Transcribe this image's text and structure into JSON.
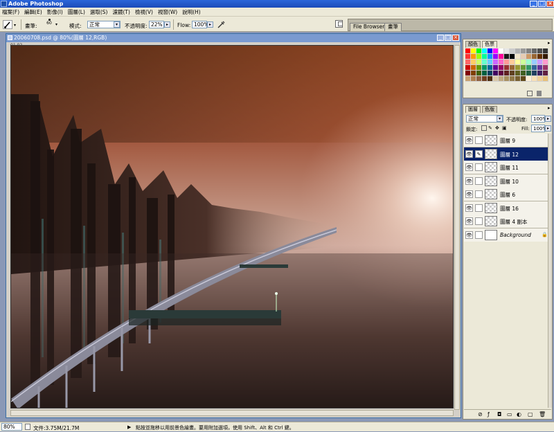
{
  "app": {
    "title": "Adobe Photoshop"
  },
  "menu": [
    "檔案(F)",
    "編輯(E)",
    "影像(I)",
    "圖層(L)",
    "選取(S)",
    "濾鏡(T)",
    "檢視(V)",
    "視窗(W)",
    "說明(H)"
  ],
  "options": {
    "brush_label": "畫筆:",
    "brush_size": "60",
    "mode_label": "模式:",
    "mode_value": "正常",
    "opacity_label": "不透明度:",
    "opacity_value": "22%",
    "flow_label": "Flow:",
    "flow_value": "100%",
    "well_tabs": [
      "File Browser",
      "畫筆"
    ]
  },
  "document": {
    "title": "20060708.psd @ 80%(圖層 12,RGB)",
    "corner_label": "01 02"
  },
  "swatches_panel": {
    "tabs": [
      "顏色",
      "色票"
    ],
    "colors": [
      "#ff0000",
      "#ffff00",
      "#00ff00",
      "#00ffff",
      "#0000ff",
      "#ff00ff",
      "#ffffff",
      "#e6e6e6",
      "#cccccc",
      "#b3b3b3",
      "#999999",
      "#808080",
      "#666666",
      "#4d4d4d",
      "#333333",
      "#ff3333",
      "#ff9900",
      "#99ff00",
      "#00ff99",
      "#0099ff",
      "#9900ff",
      "#ff0099",
      "#1a1a1a",
      "#000000",
      "#f2e6cc",
      "#e6ccb3",
      "#cc9966",
      "#996633",
      "#663300",
      "#331a00",
      "#ff6666",
      "#ffcc66",
      "#ccff66",
      "#66ffcc",
      "#66ccff",
      "#cc66ff",
      "#ff66cc",
      "#ff9999",
      "#ffcc99",
      "#ffff99",
      "#ccff99",
      "#99ffcc",
      "#99ccff",
      "#cc99ff",
      "#ff99cc",
      "#cc0000",
      "#cc6600",
      "#669900",
      "#009966",
      "#006699",
      "#660099",
      "#990066",
      "#993333",
      "#996633",
      "#999933",
      "#669933",
      "#339966",
      "#336699",
      "#663399",
      "#993366",
      "#800000",
      "#804000",
      "#406000",
      "#006040",
      "#004060",
      "#400060",
      "#600040",
      "#602020",
      "#604020",
      "#606020",
      "#406020",
      "#206040",
      "#204060",
      "#402060",
      "#602040",
      "#c8a070",
      "#b08050",
      "#906040",
      "#704020",
      "#503010",
      "#d8c8a8",
      "#c0a880",
      "#a89060",
      "#907848",
      "#786030",
      "#604818",
      "#fff0d8",
      "#f8e0b8",
      "#f0d098",
      "#e8c078"
    ],
    "icons": [
      "new-swatch-icon",
      "trash-icon"
    ]
  },
  "layers_panel": {
    "tabs": [
      "圖層",
      "色版"
    ],
    "blend_mode": "正常",
    "opacity_label": "不透明度:",
    "opacity_value": "100%",
    "lock_label": "鎖定:",
    "fill_label": "Fill:",
    "fill_value": "100%",
    "layers": [
      {
        "name": "圖層 9",
        "selected": false,
        "brush": false
      },
      {
        "name": "圖層 12",
        "selected": true,
        "brush": true
      },
      {
        "name": "圖層 11",
        "selected": false,
        "brush": false
      },
      {
        "name": "圖層 10",
        "selected": false,
        "brush": false
      },
      {
        "name": "圖層 6",
        "selected": false,
        "brush": false
      },
      {
        "name": "圖層 16",
        "selected": false,
        "brush": false
      },
      {
        "name": "圖層 4 副本",
        "selected": false,
        "brush": false
      },
      {
        "name": "Background",
        "selected": false,
        "brush": false,
        "locked": true
      }
    ],
    "bottom_icons": [
      "link-layers-icon",
      "layer-style-icon",
      "mask-icon",
      "new-set-icon",
      "adjustment-layer-icon",
      "new-layer-icon",
      "trash-icon"
    ]
  },
  "status": {
    "zoom": "80%",
    "doc_info": "文件:3.75M/21.7M",
    "hint": "點按並拖移以用前景色繪畫。要用附加選項，使用 Shift、Alt 和 Ctrl 鍵。"
  }
}
